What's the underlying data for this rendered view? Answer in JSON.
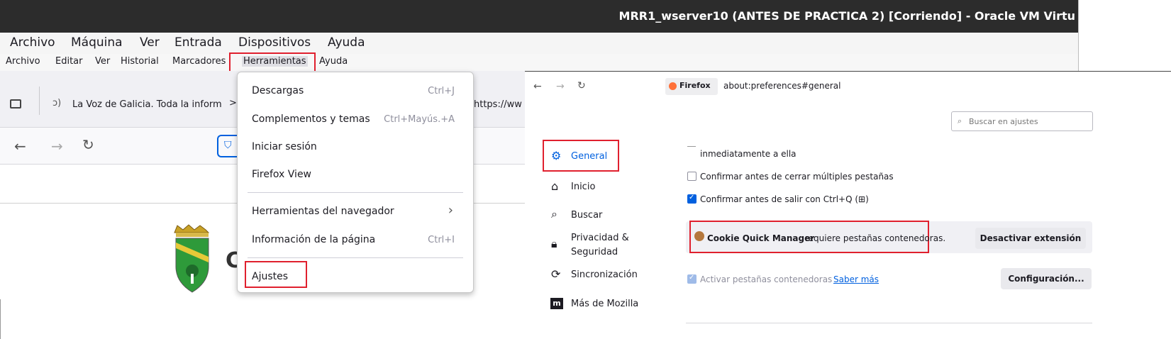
{
  "vm": {
    "title": "MRR1_wserver10 (ANTES DE PRACTICA 2) [Corriendo] - Oracle VM Virtu",
    "menu": [
      "Archivo",
      "Máquina",
      "Ver",
      "Entrada",
      "Dispositivos",
      "Ayuda"
    ]
  },
  "firefox_menu": [
    "Archivo",
    "Editar",
    "Ver",
    "Historial",
    "Marcadores",
    "Herramientas",
    "Ayuda"
  ],
  "tab": {
    "title": "La Voz de Galicia. Toda la inform",
    "url_fragment": "https://ww"
  },
  "page": {
    "heading_fragment": "C"
  },
  "tools_menu": {
    "items": [
      {
        "label": "Descargas",
        "shortcut": "Ctrl+J"
      },
      {
        "label": "Complementos y temas",
        "shortcut": "Ctrl+Mayús.+A"
      },
      {
        "label": "Iniciar sesión",
        "shortcut": ""
      },
      {
        "label": "Firefox View",
        "shortcut": ""
      },
      {
        "label": "Herramientas del navegador",
        "shortcut": ""
      },
      {
        "label": "Información de la página",
        "shortcut": "Ctrl+I"
      },
      {
        "label": "Ajustes",
        "shortcut": ""
      }
    ]
  },
  "prefs": {
    "identity": "Firefox",
    "url": "about:preferences#general",
    "search_placeholder": "Buscar en ajustes",
    "sidebar": [
      "General",
      "Inicio",
      "Buscar",
      "Privacidad &",
      "Seguridad",
      "Sincronización",
      "Más de Mozilla"
    ],
    "options": {
      "partial": "inmediatamente a ella",
      "confirm_close_tabs": "Confirmar antes de cerrar múltiples pestañas",
      "confirm_quit": "Confirmar antes de salir con Ctrl+Q (⊞)"
    },
    "notice": {
      "extension": "Cookie Quick Manager",
      "message": " requiere pestañas contenedoras.",
      "button": "Desactivar extensión"
    },
    "containers": {
      "label": "Activar pestañas contenedoras",
      "link": "Saber más",
      "button": "Configuración..."
    }
  },
  "colors": {
    "highlight": "#e0202e",
    "accent": "#0060df",
    "vm_title_bg": "#2c2c2c"
  }
}
